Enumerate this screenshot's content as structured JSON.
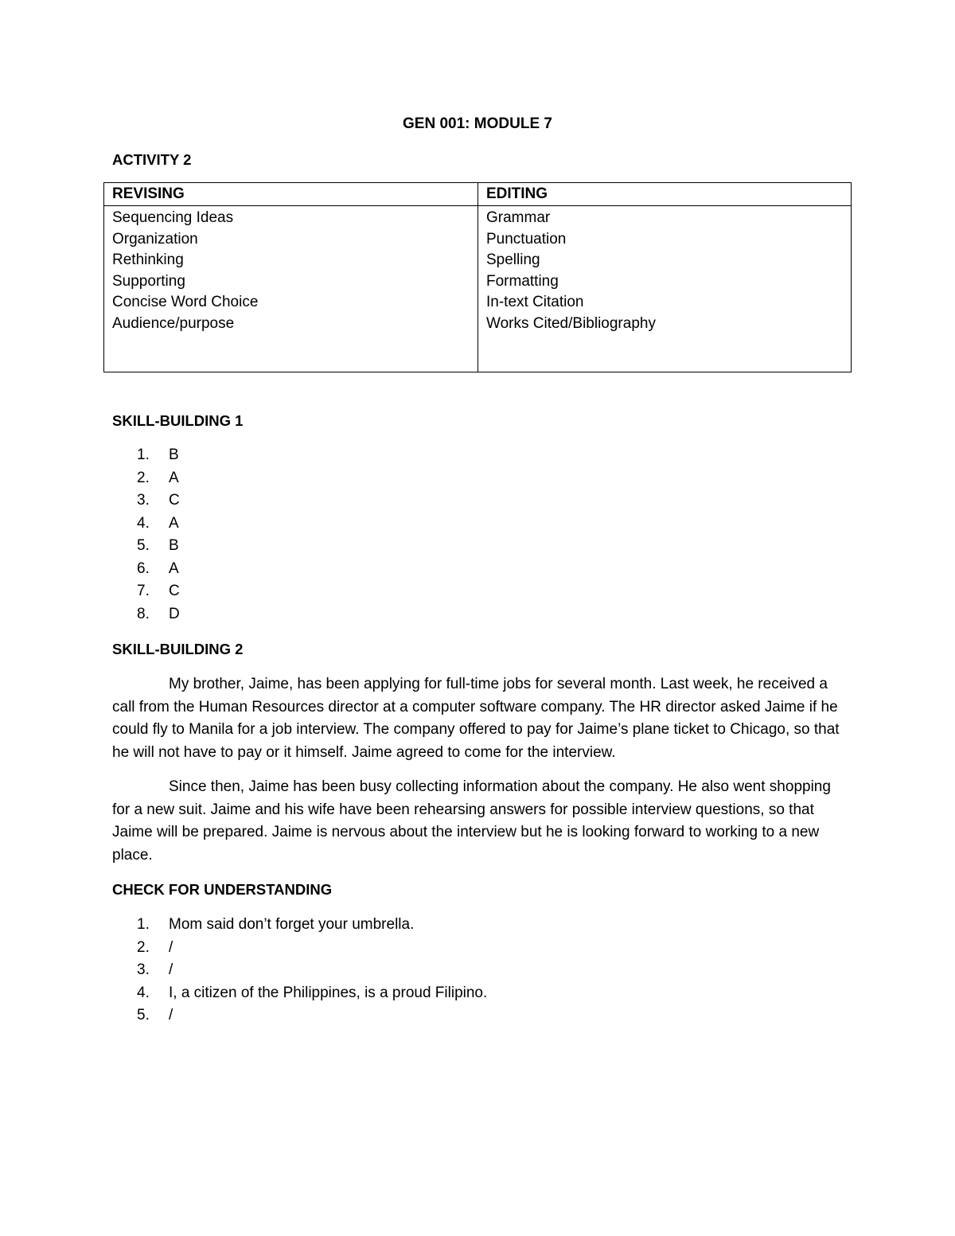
{
  "document": {
    "title": "GEN 001: MODULE 7",
    "activity2": {
      "heading": "ACTIVITY 2",
      "columns": [
        "REVISING",
        "EDITING"
      ],
      "revising": [
        "Sequencing Ideas",
        "Organization",
        "Rethinking",
        "Supporting",
        "Concise Word Choice",
        "Audience/purpose"
      ],
      "editing": [
        "Grammar",
        "Punctuation",
        "Spelling",
        "Formatting",
        "In-text Citation",
        "Works Cited/Bibliography"
      ]
    },
    "skill_building_1": {
      "heading": "SKILL-BUILDING 1",
      "items": [
        {
          "num": "1.",
          "answer": "B"
        },
        {
          "num": "2.",
          "answer": "A"
        },
        {
          "num": "3.",
          "answer": "C"
        },
        {
          "num": "4.",
          "answer": "A"
        },
        {
          "num": "5.",
          "answer": "B"
        },
        {
          "num": "6.",
          "answer": "A"
        },
        {
          "num": "7.",
          "answer": "C"
        },
        {
          "num": "8.",
          "answer": "D"
        }
      ]
    },
    "skill_building_2": {
      "heading": "SKILL-BUILDING 2",
      "paragraphs": [
        "My brother, Jaime, has been applying for full-time jobs for several month. Last week, he received a call from the Human Resources director at a computer software company. The HR director asked Jaime if he could fly to Manila for a job interview. The company offered to pay for Jaime’s plane ticket to Chicago, so that he will not have to pay or it himself. Jaime agreed to come for the interview.",
        "Since then, Jaime has been busy collecting information about the company. He also went shopping for a new suit. Jaime and his wife have been rehearsing answers for possible interview questions, so that Jaime will be prepared. Jaime is nervous about the interview but he is looking forward to working to a new place."
      ]
    },
    "check_for_understanding": {
      "heading": "CHECK FOR UNDERSTANDING",
      "items": [
        {
          "num": "1.",
          "answer": "Mom said don’t forget your umbrella."
        },
        {
          "num": "2.",
          "answer": "/"
        },
        {
          "num": "3.",
          "answer": "/"
        },
        {
          "num": "4.",
          "answer": "I, a citizen of the Philippines, is a proud Filipino."
        },
        {
          "num": "5.",
          "answer": "/"
        }
      ]
    }
  }
}
